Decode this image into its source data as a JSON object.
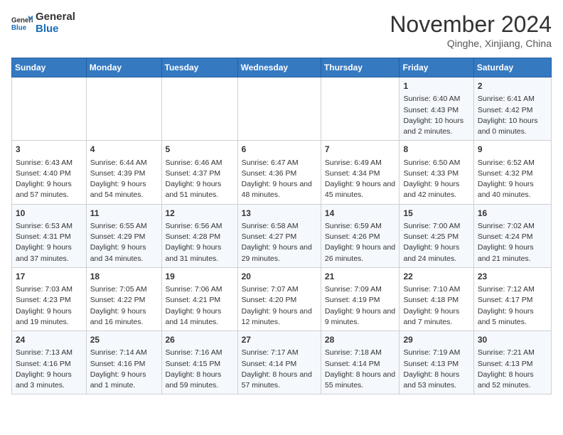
{
  "header": {
    "logo_line1": "General",
    "logo_line2": "Blue",
    "month_title": "November 2024",
    "location": "Qinghe, Xinjiang, China"
  },
  "weekdays": [
    "Sunday",
    "Monday",
    "Tuesday",
    "Wednesday",
    "Thursday",
    "Friday",
    "Saturday"
  ],
  "weeks": [
    [
      {
        "day": "",
        "text": ""
      },
      {
        "day": "",
        "text": ""
      },
      {
        "day": "",
        "text": ""
      },
      {
        "day": "",
        "text": ""
      },
      {
        "day": "",
        "text": ""
      },
      {
        "day": "1",
        "text": "Sunrise: 6:40 AM\nSunset: 4:43 PM\nDaylight: 10 hours and 2 minutes."
      },
      {
        "day": "2",
        "text": "Sunrise: 6:41 AM\nSunset: 4:42 PM\nDaylight: 10 hours and 0 minutes."
      }
    ],
    [
      {
        "day": "3",
        "text": "Sunrise: 6:43 AM\nSunset: 4:40 PM\nDaylight: 9 hours and 57 minutes."
      },
      {
        "day": "4",
        "text": "Sunrise: 6:44 AM\nSunset: 4:39 PM\nDaylight: 9 hours and 54 minutes."
      },
      {
        "day": "5",
        "text": "Sunrise: 6:46 AM\nSunset: 4:37 PM\nDaylight: 9 hours and 51 minutes."
      },
      {
        "day": "6",
        "text": "Sunrise: 6:47 AM\nSunset: 4:36 PM\nDaylight: 9 hours and 48 minutes."
      },
      {
        "day": "7",
        "text": "Sunrise: 6:49 AM\nSunset: 4:34 PM\nDaylight: 9 hours and 45 minutes."
      },
      {
        "day": "8",
        "text": "Sunrise: 6:50 AM\nSunset: 4:33 PM\nDaylight: 9 hours and 42 minutes."
      },
      {
        "day": "9",
        "text": "Sunrise: 6:52 AM\nSunset: 4:32 PM\nDaylight: 9 hours and 40 minutes."
      }
    ],
    [
      {
        "day": "10",
        "text": "Sunrise: 6:53 AM\nSunset: 4:31 PM\nDaylight: 9 hours and 37 minutes."
      },
      {
        "day": "11",
        "text": "Sunrise: 6:55 AM\nSunset: 4:29 PM\nDaylight: 9 hours and 34 minutes."
      },
      {
        "day": "12",
        "text": "Sunrise: 6:56 AM\nSunset: 4:28 PM\nDaylight: 9 hours and 31 minutes."
      },
      {
        "day": "13",
        "text": "Sunrise: 6:58 AM\nSunset: 4:27 PM\nDaylight: 9 hours and 29 minutes."
      },
      {
        "day": "14",
        "text": "Sunrise: 6:59 AM\nSunset: 4:26 PM\nDaylight: 9 hours and 26 minutes."
      },
      {
        "day": "15",
        "text": "Sunrise: 7:00 AM\nSunset: 4:25 PM\nDaylight: 9 hours and 24 minutes."
      },
      {
        "day": "16",
        "text": "Sunrise: 7:02 AM\nSunset: 4:24 PM\nDaylight: 9 hours and 21 minutes."
      }
    ],
    [
      {
        "day": "17",
        "text": "Sunrise: 7:03 AM\nSunset: 4:23 PM\nDaylight: 9 hours and 19 minutes."
      },
      {
        "day": "18",
        "text": "Sunrise: 7:05 AM\nSunset: 4:22 PM\nDaylight: 9 hours and 16 minutes."
      },
      {
        "day": "19",
        "text": "Sunrise: 7:06 AM\nSunset: 4:21 PM\nDaylight: 9 hours and 14 minutes."
      },
      {
        "day": "20",
        "text": "Sunrise: 7:07 AM\nSunset: 4:20 PM\nDaylight: 9 hours and 12 minutes."
      },
      {
        "day": "21",
        "text": "Sunrise: 7:09 AM\nSunset: 4:19 PM\nDaylight: 9 hours and 9 minutes."
      },
      {
        "day": "22",
        "text": "Sunrise: 7:10 AM\nSunset: 4:18 PM\nDaylight: 9 hours and 7 minutes."
      },
      {
        "day": "23",
        "text": "Sunrise: 7:12 AM\nSunset: 4:17 PM\nDaylight: 9 hours and 5 minutes."
      }
    ],
    [
      {
        "day": "24",
        "text": "Sunrise: 7:13 AM\nSunset: 4:16 PM\nDaylight: 9 hours and 3 minutes."
      },
      {
        "day": "25",
        "text": "Sunrise: 7:14 AM\nSunset: 4:16 PM\nDaylight: 9 hours and 1 minute."
      },
      {
        "day": "26",
        "text": "Sunrise: 7:16 AM\nSunset: 4:15 PM\nDaylight: 8 hours and 59 minutes."
      },
      {
        "day": "27",
        "text": "Sunrise: 7:17 AM\nSunset: 4:14 PM\nDaylight: 8 hours and 57 minutes."
      },
      {
        "day": "28",
        "text": "Sunrise: 7:18 AM\nSunset: 4:14 PM\nDaylight: 8 hours and 55 minutes."
      },
      {
        "day": "29",
        "text": "Sunrise: 7:19 AM\nSunset: 4:13 PM\nDaylight: 8 hours and 53 minutes."
      },
      {
        "day": "30",
        "text": "Sunrise: 7:21 AM\nSunset: 4:13 PM\nDaylight: 8 hours and 52 minutes."
      }
    ]
  ]
}
